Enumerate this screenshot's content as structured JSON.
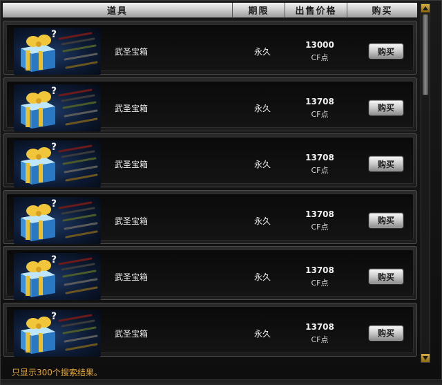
{
  "header": {
    "item_label": "道具",
    "period_label": "期限",
    "price_label": "出售价格",
    "buy_label": "购买"
  },
  "rows": [
    {
      "name": "武圣宝箱",
      "period": "永久",
      "price": "13000",
      "currency": "CF点",
      "buy": "购买",
      "icon": "gift-box-with-rifles-icon"
    },
    {
      "name": "武圣宝箱",
      "period": "永久",
      "price": "13708",
      "currency": "CF点",
      "buy": "购买",
      "icon": "gift-box-with-rifles-icon"
    },
    {
      "name": "武圣宝箱",
      "period": "永久",
      "price": "13708",
      "currency": "CF点",
      "buy": "购买",
      "icon": "gift-box-with-rifles-icon"
    },
    {
      "name": "武圣宝箱",
      "period": "永久",
      "price": "13708",
      "currency": "CF点",
      "buy": "购买",
      "icon": "gift-box-with-rifles-icon"
    },
    {
      "name": "武圣宝箱",
      "period": "永久",
      "price": "13708",
      "currency": "CF点",
      "buy": "购买",
      "icon": "gift-box-with-rifles-icon"
    },
    {
      "name": "武圣宝箱",
      "period": "永久",
      "price": "13708",
      "currency": "CF点",
      "buy": "购买",
      "icon": "gift-box-with-rifles-icon"
    }
  ],
  "footer": {
    "result_note": "只显示300个搜索结果。"
  },
  "colors": {
    "accent_gold": "#e3a634",
    "panel_bg": "#0e0e0e",
    "header_silver": "#cfcfcf"
  }
}
